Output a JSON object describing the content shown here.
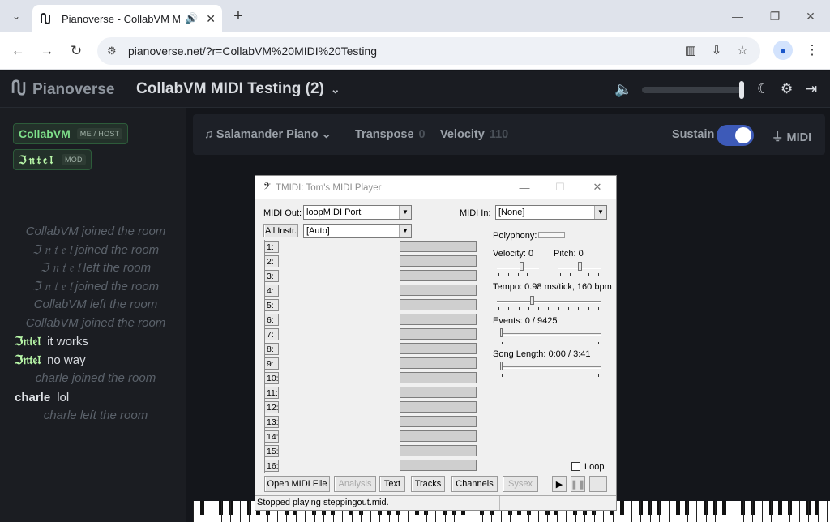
{
  "browser": {
    "tab_title": "Pianoverse - CollabVM MID",
    "url": "pianoverse.net/?r=CollabVM%20MIDI%20Testing"
  },
  "app": {
    "logo_text": "Pianoverse",
    "room_title": "CollabVM MIDI Testing (2)",
    "volume_level": 0.96
  },
  "users": [
    {
      "name": "CollabVM",
      "tag": "ME / HOST",
      "color": "#7ee08a"
    },
    {
      "name": "Intel",
      "display": "ℑ𝔫𝔱𝔢𝔩",
      "tag": "MOD",
      "color": "#b8f7a8"
    }
  ],
  "chat": [
    {
      "type": "sys",
      "text": "CollabVM joined the room"
    },
    {
      "type": "sys",
      "text": "ℑ 𝔫 𝔱 𝔢 𝔩 joined the room"
    },
    {
      "type": "sys",
      "text": "ℑ 𝔫 𝔱 𝔢 𝔩 left the room"
    },
    {
      "type": "sys",
      "text": "ℑ 𝔫 𝔱 𝔢 𝔩 joined the room"
    },
    {
      "type": "sys",
      "text": "CollabVM left the room"
    },
    {
      "type": "sys",
      "text": "CollabVM joined the room"
    },
    {
      "type": "msg",
      "who": "ℑ𝔫𝔱𝔢𝔩",
      "text": "it works",
      "color": "#b8f7a8"
    },
    {
      "type": "msg",
      "who": "ℑ𝔫𝔱𝔢𝔩",
      "text": "no way",
      "color": "#b8f7a8"
    },
    {
      "type": "sys",
      "text": "charle joined the room"
    },
    {
      "type": "msg",
      "who": "charle",
      "text": "lol",
      "color": "#e0e3e7"
    },
    {
      "type": "sys",
      "text": "charle left the room"
    }
  ],
  "controls": {
    "instrument": "Salamander Piano",
    "transpose_label": "Transpose",
    "transpose_value": "0",
    "velocity_label": "Velocity",
    "velocity_value": "110",
    "sustain_label": "Sustain",
    "sustain_on": true,
    "midi_label": "MIDI"
  },
  "tmidi": {
    "title": "TMIDI: Tom's MIDI Player",
    "midi_out_label": "MIDI Out:",
    "midi_out_value": "loopMIDI Port",
    "midi_in_label": "MIDI In:",
    "midi_in_value": "[None]",
    "all_instr_label": "All Instr.",
    "instr_value": "[Auto]",
    "channels": [
      "1:",
      "2:",
      "3:",
      "4:",
      "5:",
      "6:",
      "7:",
      "8:",
      "9:",
      "10:",
      "11:",
      "12:",
      "13:",
      "14:",
      "15:",
      "16:"
    ],
    "polyphony_label": "Polyphony:",
    "velocity_label": "Velocity: 0",
    "pitch_label": "Pitch: 0",
    "tempo_label": "Tempo: 0.98 ms/tick, 160 bpm",
    "events_label": "Events: 0 / 9425",
    "song_length_label": "Song Length: 0:00 / 3:41",
    "loop_label": "Loop",
    "buttons": {
      "open": "Open MIDI File",
      "analysis": "Analysis",
      "text": "Text",
      "tracks": "Tracks",
      "channels": "Channels",
      "sysex": "Sysex"
    },
    "status": "Stopped playing steppingout.mid."
  }
}
